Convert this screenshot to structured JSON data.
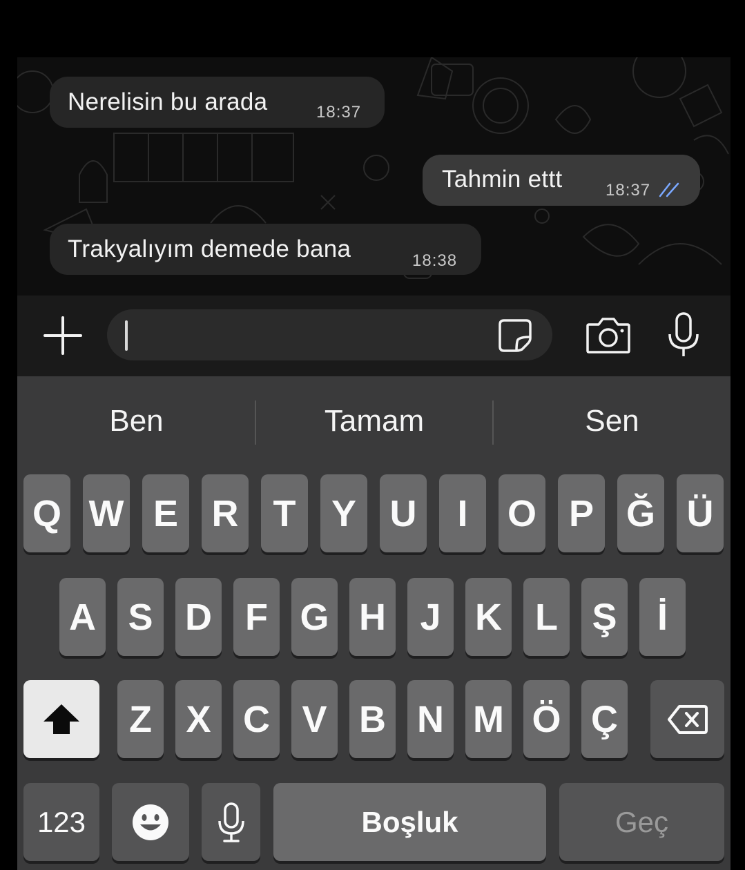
{
  "messages": [
    {
      "direction": "incoming",
      "text": "Nerelisin bu arada",
      "time": "18:37"
    },
    {
      "direction": "outgoing",
      "text": "Tahmin ettt",
      "time": "18:37",
      "status": "read-ticks"
    },
    {
      "direction": "incoming",
      "text": "Trakyalıyım demede bana",
      "time": "18:38"
    }
  ],
  "composer": {
    "attach_icon": "plus-icon",
    "sticker_icon": "sticker-icon",
    "camera_icon": "camera-icon",
    "mic_icon": "microphone-icon",
    "value": ""
  },
  "suggestions": [
    "Ben",
    "Tamam",
    "Sen"
  ],
  "keyboard": {
    "row1": [
      "Q",
      "W",
      "E",
      "R",
      "T",
      "Y",
      "U",
      "I",
      "O",
      "P",
      "Ğ",
      "Ü"
    ],
    "row2": [
      "A",
      "S",
      "D",
      "F",
      "G",
      "H",
      "J",
      "K",
      "L",
      "Ş",
      "İ"
    ],
    "row3": [
      "Z",
      "X",
      "C",
      "V",
      "B",
      "N",
      "M",
      "Ö",
      "Ç"
    ],
    "numbers_label": "123",
    "space_label": "Boşluk",
    "go_label": "Geç",
    "shift_icon": "shift-icon",
    "backspace_icon": "backspace-icon",
    "emoji_icon": "emoji-icon",
    "dictation_icon": "microphone-icon"
  },
  "colors": {
    "read_ticks": "#7aa8ff",
    "background": "#000000",
    "keyboard": "#3a3a3b"
  }
}
